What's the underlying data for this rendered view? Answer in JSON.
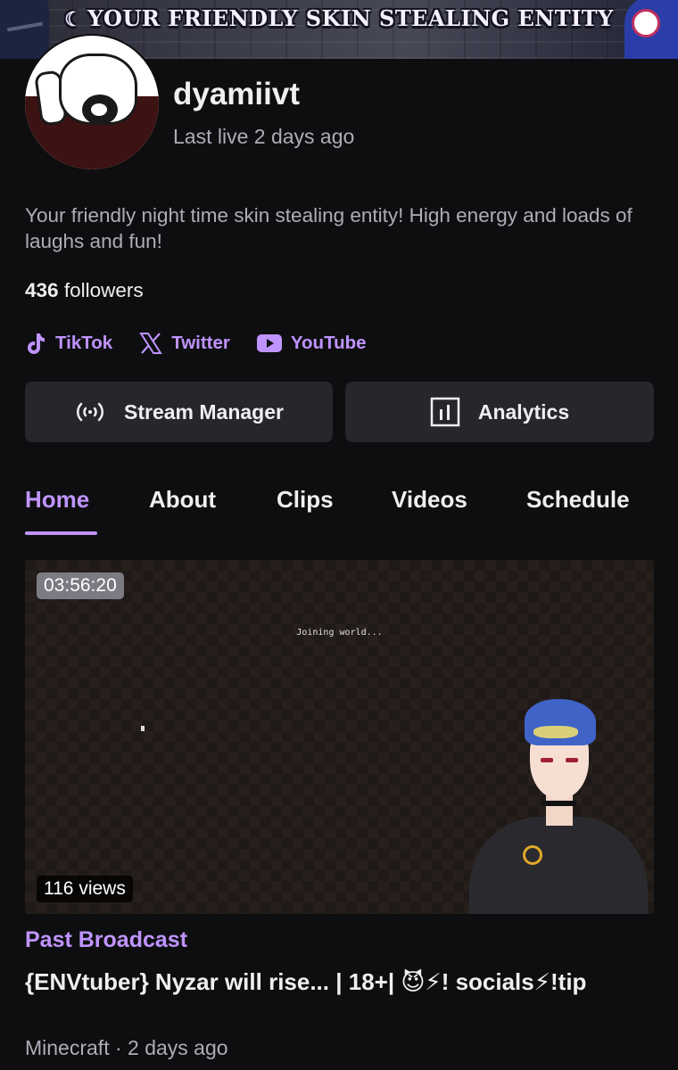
{
  "banner": {
    "text": "YOUR FRIENDLY SKIN STEALING ENTITY"
  },
  "profile": {
    "channel_name": "dyamiivt",
    "last_live": "Last live 2 days ago",
    "bio": "Your friendly night time skin stealing entity! High energy and loads of laughs and fun!",
    "followers_count": "436",
    "followers_label": "followers"
  },
  "socials": [
    {
      "label": "TikTok",
      "icon": "tiktok-icon"
    },
    {
      "label": "Twitter",
      "icon": "x-twitter-icon"
    },
    {
      "label": "YouTube",
      "icon": "youtube-icon"
    }
  ],
  "actions": {
    "stream_manager": "Stream Manager",
    "analytics": "Analytics"
  },
  "tabs": [
    {
      "label": "Home",
      "active": true
    },
    {
      "label": "About",
      "active": false
    },
    {
      "label": "Clips",
      "active": false
    },
    {
      "label": "Videos",
      "active": false
    },
    {
      "label": "Schedule",
      "active": false
    }
  ],
  "video": {
    "duration": "03:56:20",
    "views": "116 views",
    "overlay_text": "Joining world...",
    "type_label": "Past Broadcast",
    "title": "{ENVtuber} Nyzar will rise... | 18+| 😈⚡! socials⚡!tip",
    "meta": "Minecraft · 2 days ago"
  },
  "colors": {
    "background": "#0e0e10",
    "accent": "#bf94ff",
    "button_bg": "#26262c",
    "muted_text": "#adadb8"
  }
}
